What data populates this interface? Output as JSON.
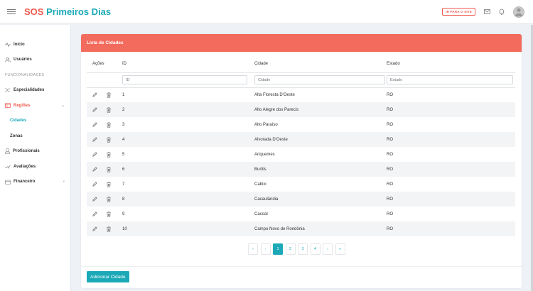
{
  "header": {
    "brand_first": "SOS",
    "brand_rest": "Primeiros Dias",
    "site_button": "IR PARA O SITE"
  },
  "sidebar": {
    "items": [
      {
        "label": "Início",
        "icon": "activity-icon"
      },
      {
        "label": "Usuários",
        "icon": "users-icon"
      }
    ],
    "section": "FUNCIONALIDADES",
    "items2": [
      {
        "label": "Especialidades",
        "icon": "shuffle-icon"
      },
      {
        "label": "Regiões",
        "icon": "map-icon",
        "chevron": "⌄"
      }
    ],
    "sub": [
      {
        "label": "Cidades"
      },
      {
        "label": "Zonas"
      }
    ],
    "items3": [
      {
        "label": "Profissionais",
        "icon": "briefcase-icon"
      },
      {
        "label": "Avaliações",
        "icon": "check-icon"
      },
      {
        "label": "Financeiro",
        "icon": "wallet-icon",
        "chevron": "‹"
      }
    ]
  },
  "card": {
    "title": "Lista de Cidades",
    "columns": {
      "acoes": "Ações",
      "id": "ID",
      "cidade": "Cidade",
      "estado": "Estado"
    },
    "placeholders": {
      "id": "ID",
      "cidade": "Cidade",
      "estado": "Estado"
    },
    "rows": [
      {
        "id": "1",
        "cidade": "Alta Floresta D'Oeste",
        "estado": "RO"
      },
      {
        "id": "2",
        "cidade": "Alto Alegre dos Parecis",
        "estado": "RO"
      },
      {
        "id": "3",
        "cidade": "Alto Paraíso",
        "estado": "RO"
      },
      {
        "id": "4",
        "cidade": "Alvorada D'Oeste",
        "estado": "RO"
      },
      {
        "id": "5",
        "cidade": "Ariquemes",
        "estado": "RO"
      },
      {
        "id": "6",
        "cidade": "Buritis",
        "estado": "RO"
      },
      {
        "id": "7",
        "cidade": "Cabixi",
        "estado": "RO"
      },
      {
        "id": "8",
        "cidade": "Cacaulândia",
        "estado": "RO"
      },
      {
        "id": "9",
        "cidade": "Cacoal",
        "estado": "RO"
      },
      {
        "id": "10",
        "cidade": "Campo Novo de Rondônia",
        "estado": "RO"
      }
    ],
    "pagination": {
      "first": "«",
      "prev": "‹",
      "pages": [
        "1",
        "2",
        "3",
        "4"
      ],
      "next": "›",
      "last": "»",
      "current": "1"
    },
    "add_button": "Adicionar Cidade"
  },
  "colors": {
    "brand_red": "#ef5a4f",
    "brand_teal": "#1ba9b7",
    "header_salmon": "#f36b5d"
  }
}
